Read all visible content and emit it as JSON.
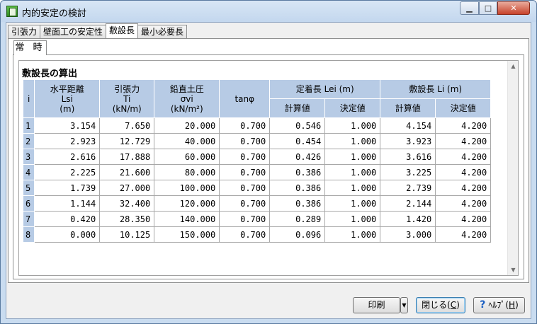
{
  "window": {
    "title": "内的安定の検討",
    "min_label": "▁",
    "max_label": "□",
    "close_label": "✕"
  },
  "tabs": [
    "引張力",
    "壁面工の安定性",
    "敷設長",
    "最小必要長"
  ],
  "active_tab_index": 2,
  "subtab": "常 時",
  "section_title": "敷設長の算出",
  "table": {
    "headers": {
      "i": "i",
      "lsi": [
        "水平距離",
        "Lsi",
        "(m)"
      ],
      "ti": [
        "引張力",
        "Ti",
        "(kN/m)"
      ],
      "sigma": [
        "鉛直土圧",
        "σvi",
        "(kN/m²)"
      ],
      "tan": "tanφ",
      "lei": "定着長 Lei (m)",
      "li": "敷設長 Li (m)",
      "calc": "計算値",
      "decided": "決定値"
    },
    "rows": [
      [
        "1",
        "3.154",
        "7.650",
        "20.000",
        "0.700",
        "0.546",
        "1.000",
        "4.154",
        "4.200"
      ],
      [
        "2",
        "2.923",
        "12.729",
        "40.000",
        "0.700",
        "0.454",
        "1.000",
        "3.923",
        "4.200"
      ],
      [
        "3",
        "2.616",
        "17.888",
        "60.000",
        "0.700",
        "0.426",
        "1.000",
        "3.616",
        "4.200"
      ],
      [
        "4",
        "2.225",
        "21.600",
        "80.000",
        "0.700",
        "0.386",
        "1.000",
        "3.225",
        "4.200"
      ],
      [
        "5",
        "1.739",
        "27.000",
        "100.000",
        "0.700",
        "0.386",
        "1.000",
        "2.739",
        "4.200"
      ],
      [
        "6",
        "1.144",
        "32.400",
        "120.000",
        "0.700",
        "0.386",
        "1.000",
        "2.144",
        "4.200"
      ],
      [
        "7",
        "0.420",
        "28.350",
        "140.000",
        "0.700",
        "0.289",
        "1.000",
        "1.420",
        "4.200"
      ],
      [
        "8",
        "0.000",
        "10.125",
        "150.000",
        "0.700",
        "0.096",
        "1.000",
        "3.000",
        "4.200"
      ]
    ]
  },
  "buttons": {
    "print": "印刷",
    "print_arrow": "▼",
    "close_prefix": "閉じる(",
    "close_key": "C",
    "close_suffix": ")",
    "help_icon": "?",
    "help_prefix": "ﾍﾙﾌﾟ(",
    "help_key": "H",
    "help_suffix": ")"
  },
  "scroll": {
    "up": "▲",
    "down": "▼"
  }
}
